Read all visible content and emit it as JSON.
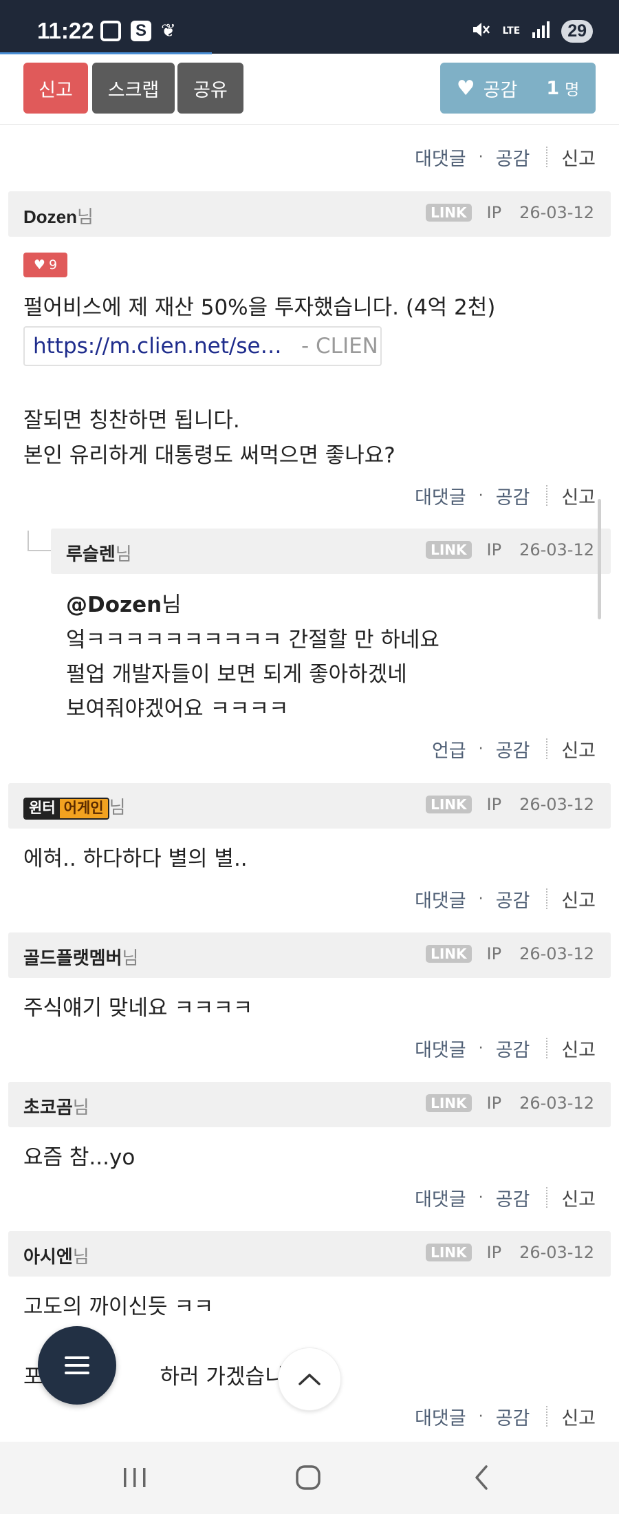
{
  "status_bar": {
    "time": "11:22",
    "network": "LTE",
    "battery": "29",
    "icons": [
      "screenshot-icon",
      "s-app-icon",
      "leaf-icon",
      "mute-icon",
      "signal-icon"
    ]
  },
  "action_bar": {
    "report_label": "신고",
    "scrap_label": "스크랩",
    "share_label": "공유",
    "like_label": "공감",
    "like_count": "1",
    "like_unit": "명"
  },
  "labels": {
    "reply": "대댓글",
    "mention": "언급",
    "like": "공감",
    "report": "신고",
    "nim": "님",
    "link": "LINK",
    "ip": "IP",
    "dot": "·"
  },
  "comments": [
    {
      "nick": "Dozen",
      "date": "26-03-12",
      "like_badge": "9",
      "line1": "펄어비스에 제 재산 50%을 투자했습니다. (4억 2천)",
      "link_url": "https://m.clien.net/service/board/park",
      "link_site": "- CLIEN",
      "line2": "잘되면 칭찬하면 됩니다.",
      "line3": "본인 유리하게 대통령도 써먹으면 좋나요?"
    },
    {
      "nick": "루슬렌",
      "date": "26-03-12",
      "mention": "@Dozen",
      "line1": "엌ㅋㅋㅋㅋㅋㅋㅋㅋㅋㅋ 간절할 만 하네요",
      "line2": "펄업 개발자들이 보면 되게 좋아하겠네",
      "line3": "보여줘야겠어요 ㅋㅋㅋㅋ"
    },
    {
      "nick_logo_part1": "윈터",
      "nick_logo_part2": "어게인",
      "date": "26-03-12",
      "line1": "에혀.. 하다하다 별의 별.."
    },
    {
      "nick": "골드플랫멤버",
      "date": "26-03-12",
      "line1": "주식얘기 맞네요 ㅋㅋㅋㅋ"
    },
    {
      "nick": "초코곰",
      "date": "26-03-12",
      "line1": "요즘 참...yo"
    },
    {
      "nick": "아시엔",
      "date": "26-03-12",
      "line1": "고도의 까이신듯 ㅋㅋ",
      "line2_start": "포",
      "line2_end": "하러 가겠습니다"
    }
  ]
}
